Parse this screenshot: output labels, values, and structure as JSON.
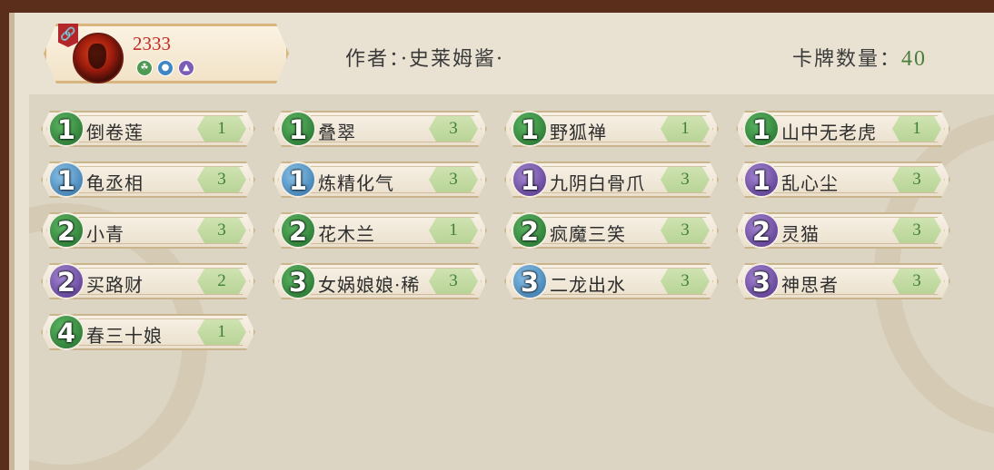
{
  "header": {
    "player_score": "2333",
    "author_label": "作者：·史莱姆酱·",
    "card_count_label": "卡牌数量：",
    "card_count_value": "40",
    "mini_icons": [
      "leaf-icon",
      "water-drop-icon",
      "mountain-icon"
    ],
    "link_icon": "link-icon"
  },
  "colors": {
    "cost_green": "#2f8a3a",
    "cost_blue": "#3b7fb6",
    "cost_purple": "#5e3c96",
    "quantity_green": "#3f7f3a"
  },
  "cards": [
    {
      "cost": "1",
      "color": "green",
      "name": "倒卷莲",
      "qty": "1"
    },
    {
      "cost": "1",
      "color": "green",
      "name": "叠翠",
      "qty": "3"
    },
    {
      "cost": "1",
      "color": "green",
      "name": "野狐禅",
      "qty": "1"
    },
    {
      "cost": "1",
      "color": "green",
      "name": "山中无老虎",
      "qty": "1"
    },
    {
      "cost": "1",
      "color": "blue",
      "name": "龟丞相",
      "qty": "3"
    },
    {
      "cost": "1",
      "color": "blue",
      "name": "炼精化气",
      "qty": "3"
    },
    {
      "cost": "1",
      "color": "purple",
      "name": "九阴白骨爪",
      "qty": "3"
    },
    {
      "cost": "1",
      "color": "purple",
      "name": "乱心尘",
      "qty": "3"
    },
    {
      "cost": "2",
      "color": "green",
      "name": "小青",
      "qty": "3"
    },
    {
      "cost": "2",
      "color": "green",
      "name": "花木兰",
      "qty": "1"
    },
    {
      "cost": "2",
      "color": "green",
      "name": "疯魔三笑",
      "qty": "3"
    },
    {
      "cost": "2",
      "color": "purple",
      "name": "灵猫",
      "qty": "3"
    },
    {
      "cost": "2",
      "color": "purple",
      "name": "买路财",
      "qty": "2"
    },
    {
      "cost": "3",
      "color": "green",
      "name": "女娲娘娘·稀",
      "qty": "3"
    },
    {
      "cost": "3",
      "color": "blue",
      "name": "二龙出水",
      "qty": "3"
    },
    {
      "cost": "3",
      "color": "purple",
      "name": "神思者",
      "qty": "3"
    },
    {
      "cost": "4",
      "color": "green",
      "name": "春三十娘",
      "qty": "1"
    }
  ]
}
